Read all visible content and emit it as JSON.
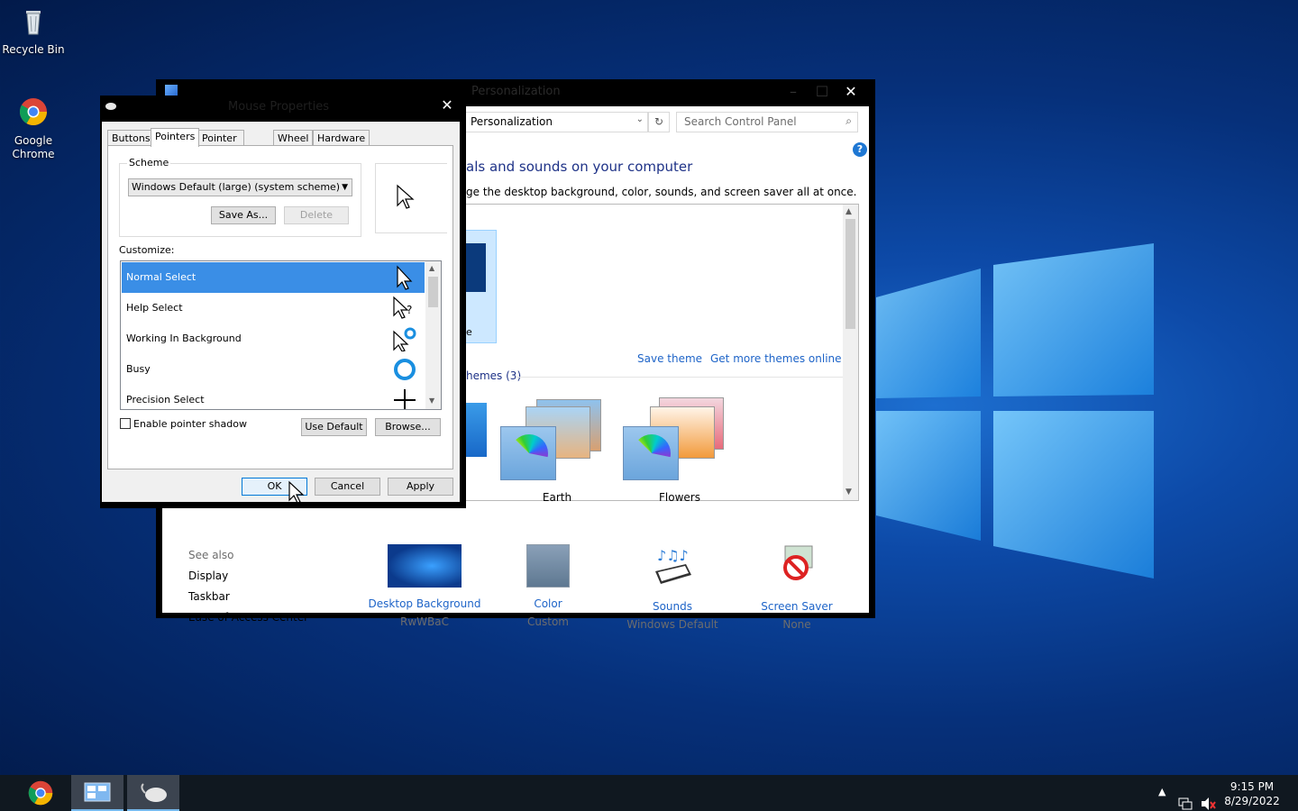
{
  "desktop": {
    "icons": [
      {
        "label": "Recycle Bin",
        "icon": "recycle-bin-icon"
      },
      {
        "label": "Google\nChrome",
        "icon": "chrome-icon"
      }
    ],
    "accent": "#0d4aa8"
  },
  "personalization": {
    "title": "Personalization",
    "address": "Personalization",
    "search_placeholder": "Search Control Panel",
    "heading": "als and sounds on your computer",
    "subheading": "ge the desktop background, color, sounds, and screen saver all at once.",
    "selected_theme_caption": "e",
    "save_theme": "Save theme",
    "get_more": "Get more themes online",
    "group_label": "hemes (3)",
    "themes": [
      {
        "name": "Earth"
      },
      {
        "name": "Flowers"
      }
    ],
    "see_also": {
      "header": "See also",
      "links": [
        "Display",
        "Taskbar",
        "Ease of Access Center"
      ]
    },
    "options": [
      {
        "label": "Desktop Background",
        "value": "RwWBaC",
        "icon": "desktop-background-icon"
      },
      {
        "label": "Color",
        "value": "Custom",
        "icon": "color-icon"
      },
      {
        "label": "Sounds",
        "value": "Windows Default",
        "icon": "sounds-icon"
      },
      {
        "label": "Screen Saver",
        "value": "None",
        "icon": "screen-saver-icon"
      }
    ],
    "link_color": "#1e64c8"
  },
  "mouse": {
    "title": "Mouse Properties",
    "tabs": [
      "Buttons",
      "Pointers",
      "Pointer Options",
      "Wheel",
      "Hardware"
    ],
    "active_tab": "Pointers",
    "scheme_legend": "Scheme",
    "scheme_value": "Windows Default (large) (system scheme)",
    "save_as": "Save As...",
    "delete": "Delete",
    "customize_label": "Customize:",
    "cursors": [
      {
        "name": "Normal Select",
        "icon": "normal-select-cursor-icon",
        "selected": true
      },
      {
        "name": "Help Select",
        "icon": "help-select-cursor-icon",
        "selected": false
      },
      {
        "name": "Working In Background",
        "icon": "working-cursor-icon",
        "selected": false
      },
      {
        "name": "Busy",
        "icon": "busy-cursor-icon",
        "selected": false
      },
      {
        "name": "Precision Select",
        "icon": "precision-cursor-icon",
        "selected": false
      }
    ],
    "shadow_label": "Enable pointer shadow",
    "use_default": "Use Default",
    "browse": "Browse...",
    "ok": "OK",
    "cancel": "Cancel",
    "apply": "Apply",
    "selection_color": "#3a8ee6"
  },
  "taskbar": {
    "time": "9:15 PM",
    "date": "8/29/2022"
  }
}
